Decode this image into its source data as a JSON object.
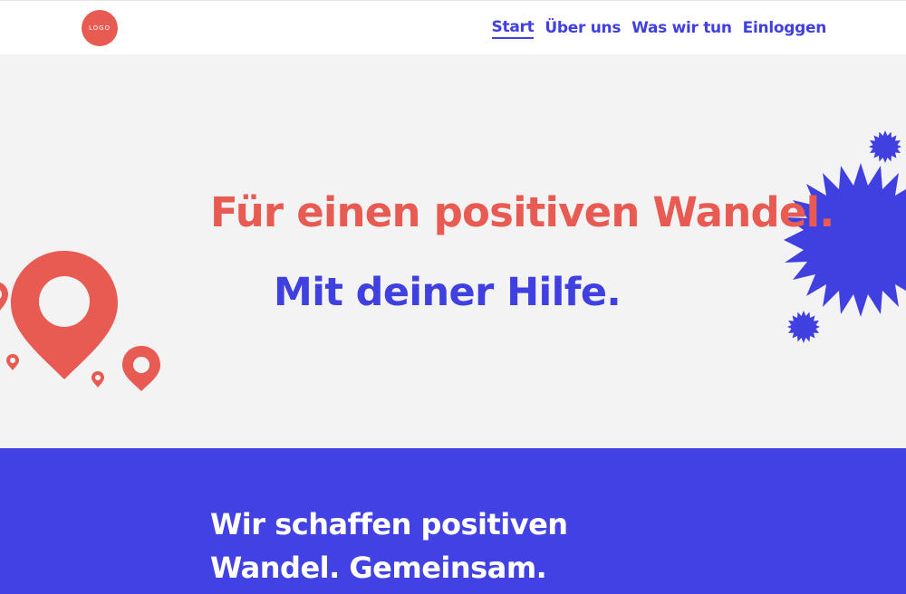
{
  "header": {
    "logo_text": "LOGO",
    "nav": [
      {
        "label": "Start",
        "active": true
      },
      {
        "label": "Über uns",
        "active": false
      },
      {
        "label": "Was wir tun",
        "active": false
      },
      {
        "label": "Einloggen",
        "active": false
      }
    ]
  },
  "hero": {
    "title": "Für einen positiven Wandel.",
    "subtitle": "Mit deiner Hilfe."
  },
  "mission": {
    "line1": "Wir schaffen positiven",
    "line2": "Wandel. Gemeinsam."
  },
  "colors": {
    "coral": "#e85b52",
    "blue": "#4040e0",
    "hero_background": "#f3f3f3",
    "section_blue": "#4242e4"
  },
  "icons": [
    "map-pin-icon",
    "starburst-icon"
  ]
}
